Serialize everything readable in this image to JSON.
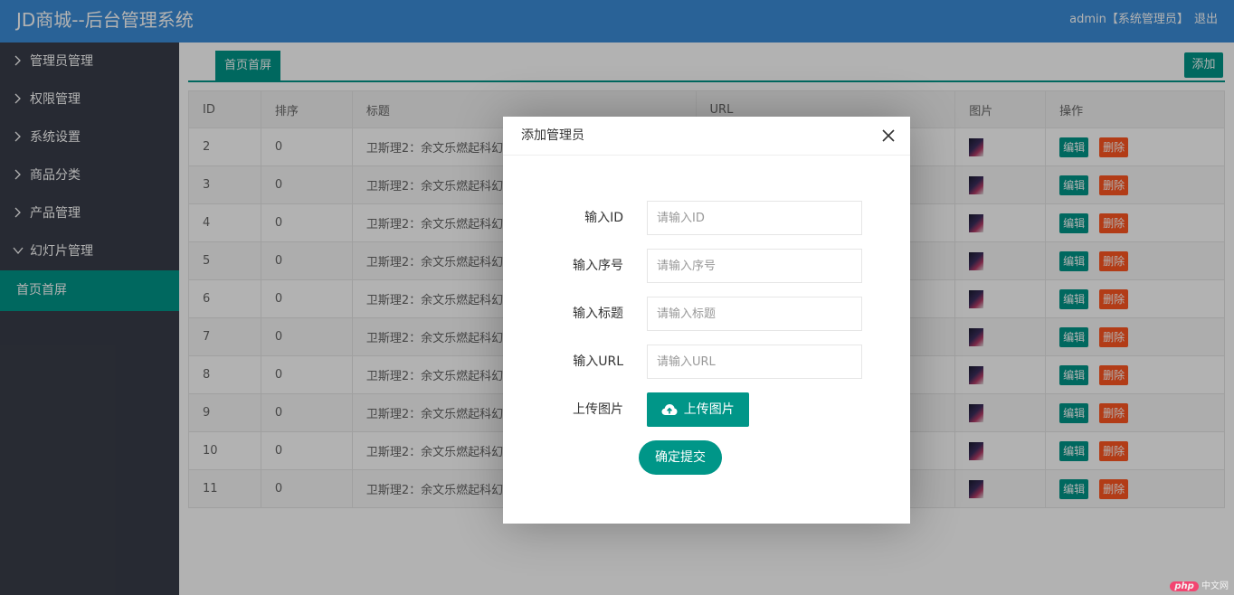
{
  "header": {
    "title": "JD商城--后台管理系统",
    "user": "admin【系统管理员】",
    "logout": "退出"
  },
  "sidebar": {
    "items": [
      {
        "label": "管理员管理",
        "icon": "chevron-right-icon"
      },
      {
        "label": "权限管理",
        "icon": "chevron-right-icon"
      },
      {
        "label": "系统设置",
        "icon": "chevron-right-icon"
      },
      {
        "label": "商品分类",
        "icon": "chevron-right-icon"
      },
      {
        "label": "产品管理",
        "icon": "chevron-right-icon"
      },
      {
        "label": "幻灯片管理",
        "icon": "chevron-down-icon"
      },
      {
        "label": "首页首屏",
        "active": true
      }
    ]
  },
  "main": {
    "tab": "首页首屏",
    "add_label": "添加",
    "columns": [
      "ID",
      "排序",
      "标题",
      "URL",
      "图片",
      "操作"
    ],
    "rows": [
      {
        "id": "2",
        "sort": "0",
        "title": "卫斯理2：余文乐燃起科幻",
        "url": ""
      },
      {
        "id": "3",
        "sort": "0",
        "title": "卫斯理2：余文乐燃起科幻",
        "url": ""
      },
      {
        "id": "4",
        "sort": "0",
        "title": "卫斯理2：余文乐燃起科幻",
        "url": ""
      },
      {
        "id": "5",
        "sort": "0",
        "title": "卫斯理2：余文乐燃起科幻",
        "url": ""
      },
      {
        "id": "6",
        "sort": "0",
        "title": "卫斯理2：余文乐燃起科幻",
        "url": ""
      },
      {
        "id": "7",
        "sort": "0",
        "title": "卫斯理2：余文乐燃起科幻",
        "url": ""
      },
      {
        "id": "8",
        "sort": "0",
        "title": "卫斯理2：余文乐燃起科幻",
        "url": ""
      },
      {
        "id": "9",
        "sort": "0",
        "title": "卫斯理2：余文乐燃起科幻",
        "url": ""
      },
      {
        "id": "10",
        "sort": "0",
        "title": "卫斯理2：余文乐燃起科幻",
        "url": ""
      },
      {
        "id": "11",
        "sort": "0",
        "title": "卫斯理2：余文乐燃起科幻",
        "url": ""
      }
    ],
    "edit_label": "编辑",
    "delete_label": "删除"
  },
  "modal": {
    "title": "添加管理员",
    "fields": [
      {
        "label": "输入ID",
        "placeholder": "请输入ID",
        "value": ""
      },
      {
        "label": "输入序号",
        "placeholder": "请输入序号",
        "value": ""
      },
      {
        "label": "输入标题",
        "placeholder": "请输入标题",
        "value": ""
      },
      {
        "label": "输入URL",
        "placeholder": "请输入URL",
        "value": ""
      }
    ],
    "upload_label": "上传图片",
    "upload_button": "上传图片",
    "submit": "确定提交"
  },
  "watermark": {
    "brand": "php",
    "text": "中文网"
  },
  "colors": {
    "header": "#3c8dd8",
    "sidebar": "#393d49",
    "accent": "#009688",
    "danger": "#ff5722"
  }
}
